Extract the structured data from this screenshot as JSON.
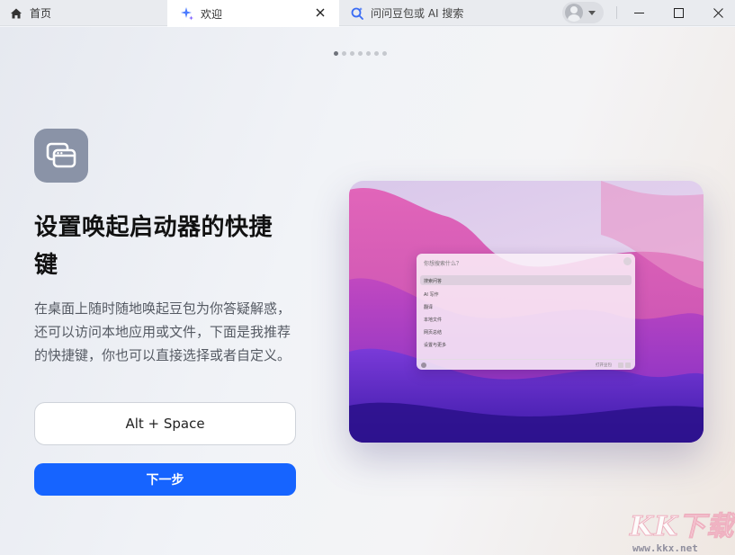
{
  "tabs": [
    {
      "label": "首页",
      "icon": "home-icon"
    },
    {
      "label": "欢迎",
      "icon": "sparkle-icon",
      "active": true
    },
    {
      "label": "问问豆包或 AI 搜索",
      "icon": "ai-search-icon"
    }
  ],
  "colors": {
    "accent": "#1664ff",
    "icon_bg": "#8a93a7",
    "tab_active": "#ffffff",
    "tab_bar": "#e9ebef"
  },
  "carousel": {
    "total": 7,
    "current": 1
  },
  "onboarding": {
    "icon": "window-stack-icon",
    "title": "设置唤起启动器的快捷键",
    "description": "在桌面上随时随地唤起豆包为你答疑解惑，还可以访问本地应用或文件，下面是我推荐的快捷键，你也可以直接选择或者自定义。",
    "shortcut": "Alt + Space",
    "next_label": "下一步"
  },
  "preview": {
    "search_placeholder": "你想搜索什么？",
    "items": [
      "搜索问答",
      "AI 写作",
      "翻译",
      "本地文件",
      "网页总结",
      "设置与更多"
    ],
    "footer_hint": "打开豆包"
  },
  "watermark": {
    "logo": "KK下载",
    "url": "www.kkx.net"
  }
}
